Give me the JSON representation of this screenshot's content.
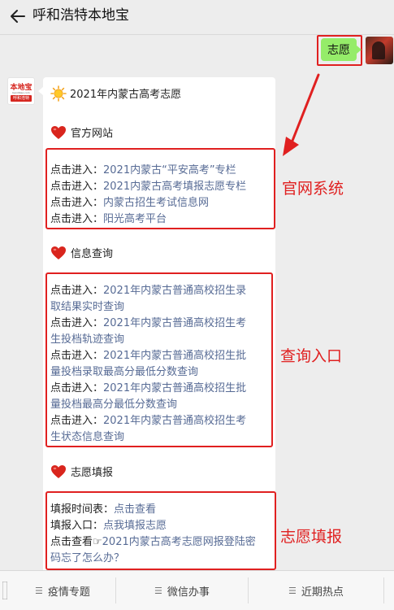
{
  "header": {
    "title": "呼和浩特本地宝"
  },
  "outgoing": {
    "text": "志愿"
  },
  "bot": {
    "logo_text": "本地宝",
    "logo_url": "bendibao.com",
    "logo_city": "呼和浩特"
  },
  "card": {
    "title": "2021年内蒙古高考志愿",
    "sections": [
      {
        "heading": "官方网站",
        "lines": [
          {
            "prefix": "点击进入：",
            "link": "2021内蒙古“平安高考”专栏"
          },
          {
            "prefix": "点击进入：",
            "link": "2021内蒙古高考填报志愿专栏"
          },
          {
            "prefix": "点击进入：",
            "link": "内蒙古招生考试信息网"
          },
          {
            "prefix": "点击进入：",
            "link": "阳光高考平台"
          }
        ]
      },
      {
        "heading": "信息查询",
        "lines": [
          {
            "prefix": "点击进入：",
            "link": "2021年内蒙古普通高校招生录"
          },
          {
            "prefix": "",
            "link": "取结果实时查询"
          },
          {
            "prefix": "点击进入：",
            "link": "2021年内蒙古普通高校招生考"
          },
          {
            "prefix": "",
            "link": "生投档轨迹查询"
          },
          {
            "prefix": "点击进入：",
            "link": "2021年内蒙古普通高校招生批"
          },
          {
            "prefix": "",
            "link": "量投档录取最高分最低分数查询"
          },
          {
            "prefix": "点击进入：",
            "link": "2021年内蒙古普通高校招生批"
          },
          {
            "prefix": "",
            "link": "量投档最高分最低分数查询"
          },
          {
            "prefix": "点击进入：",
            "link": "2021年内蒙古普通高校招生考"
          },
          {
            "prefix": "",
            "link": "生状态信息查询"
          }
        ]
      },
      {
        "heading": "志愿填报",
        "lines": [
          {
            "prefix": "填报时间表：",
            "link": "点击查看"
          },
          {
            "prefix": "填报入口：",
            "link": "点我填报志愿"
          },
          {
            "prefix": "点击查看☞",
            "link": "2021内蒙古高考志愿网报登陆密"
          },
          {
            "prefix": "",
            "link": "码忘了怎么办？"
          }
        ]
      }
    ]
  },
  "annotations": {
    "a1": "官网系统",
    "a2": "查询入口",
    "a3": "志愿填报"
  },
  "menu": [
    {
      "label": "疫情专题"
    },
    {
      "label": "微信办事"
    },
    {
      "label": "近期热点"
    }
  ],
  "colors": {
    "link": "#576b95",
    "annotation": "#e02020",
    "bubble": "#95ec69"
  }
}
